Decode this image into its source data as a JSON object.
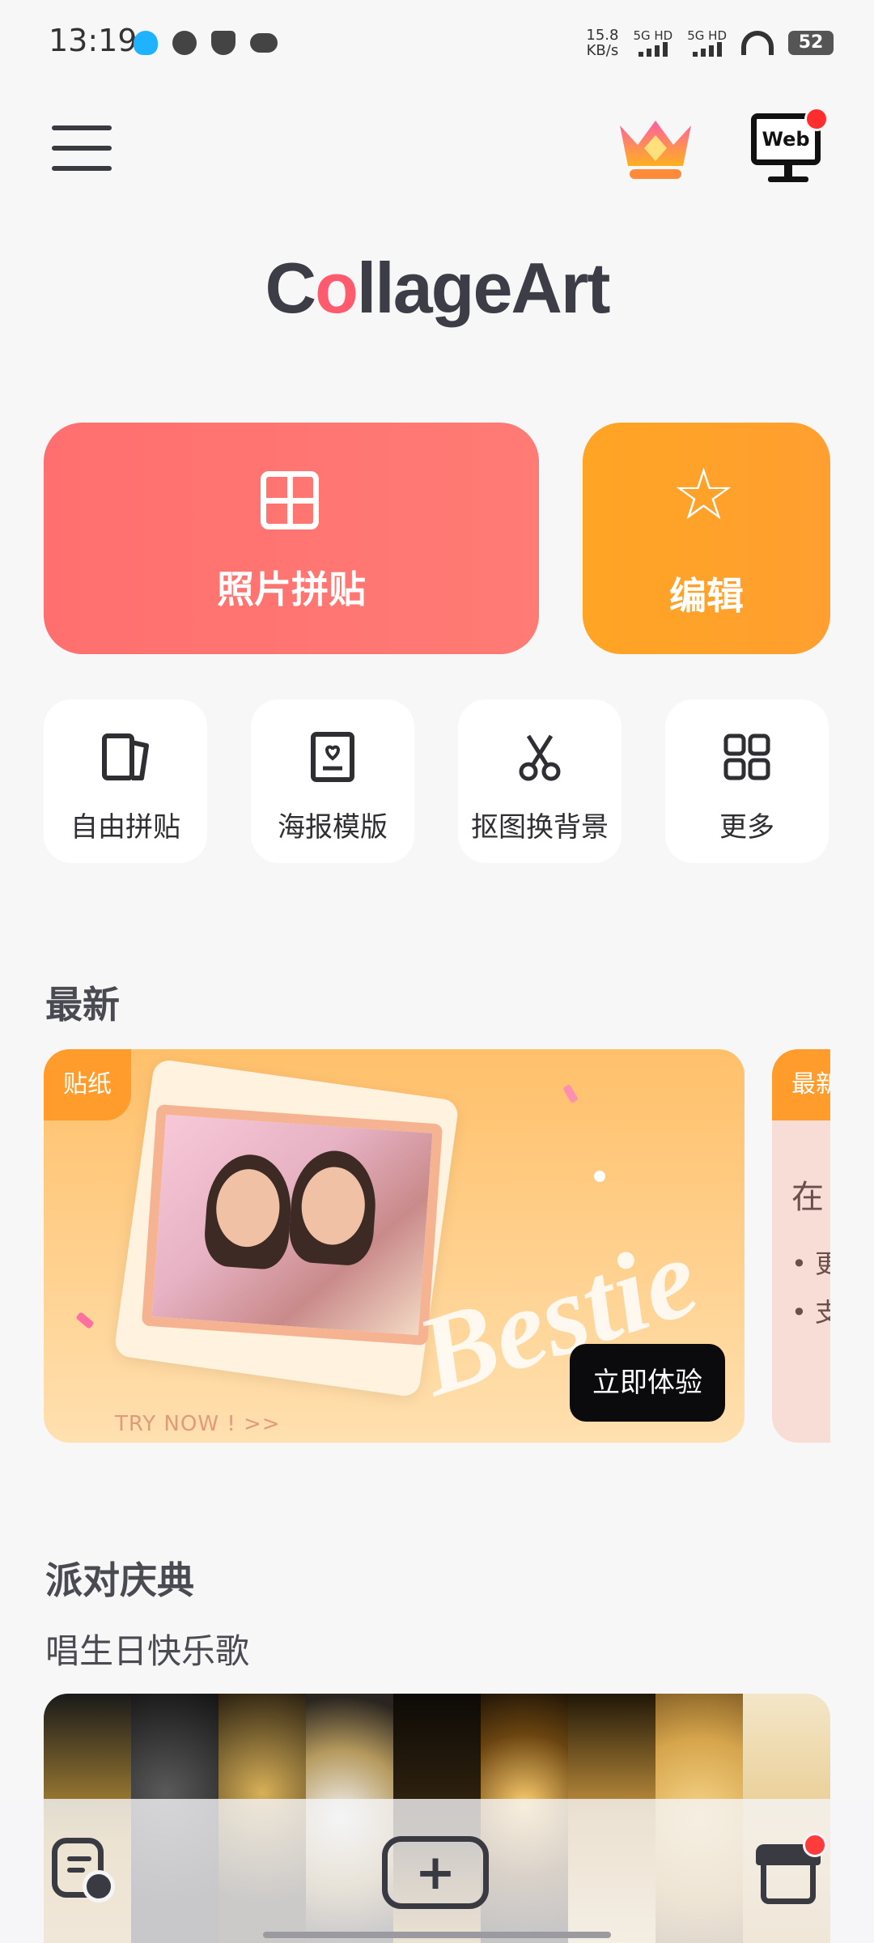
{
  "status_bar": {
    "time": "13:19",
    "speed_value": "15.8",
    "speed_unit": "KB/s",
    "sim1": "5G HD",
    "sim2": "5G HD",
    "battery": "52"
  },
  "header": {
    "brand": "CollageArt",
    "brand_parts": [
      "C",
      "o",
      "llageArt"
    ],
    "web_label": "Web",
    "icons": [
      "menu-icon",
      "crown-icon",
      "web-monitor-icon"
    ]
  },
  "main_actions": {
    "collage": {
      "label": "照片拼贴",
      "icon": "grid-icon",
      "color": "#ff6f6f"
    },
    "edit": {
      "label": "编辑",
      "icon": "magic-star-icon",
      "color": "#ffa424"
    }
  },
  "tiles": [
    {
      "label": "自由拼贴",
      "icon": "free-collage-icon"
    },
    {
      "label": "海报模版",
      "icon": "poster-icon"
    },
    {
      "label": "抠图换背景",
      "icon": "scissors-icon"
    },
    {
      "label": "更多",
      "icon": "more-grid-icon"
    }
  ],
  "latest": {
    "title": "最新",
    "banner": {
      "tag": "贴纸",
      "headline": "Bestie",
      "cta_hint": "TRY NOW ! >>",
      "cta": "立即体验"
    },
    "banner2": {
      "tag": "最新",
      "text": "在",
      "bullet1": "• 更",
      "bullet2": "• 支"
    }
  },
  "party": {
    "title": "派对庆典",
    "subtitle": "唱生日快乐歌"
  },
  "bottom_nav": {
    "items": [
      "history-icon",
      "add-icon",
      "store-icon"
    ],
    "add_symbol": "+"
  },
  "colors": {
    "accent_red": "#ff6f6f",
    "accent_orange": "#ffa424",
    "text_dark": "#2e2e33",
    "notification": "#ff2d2d"
  }
}
